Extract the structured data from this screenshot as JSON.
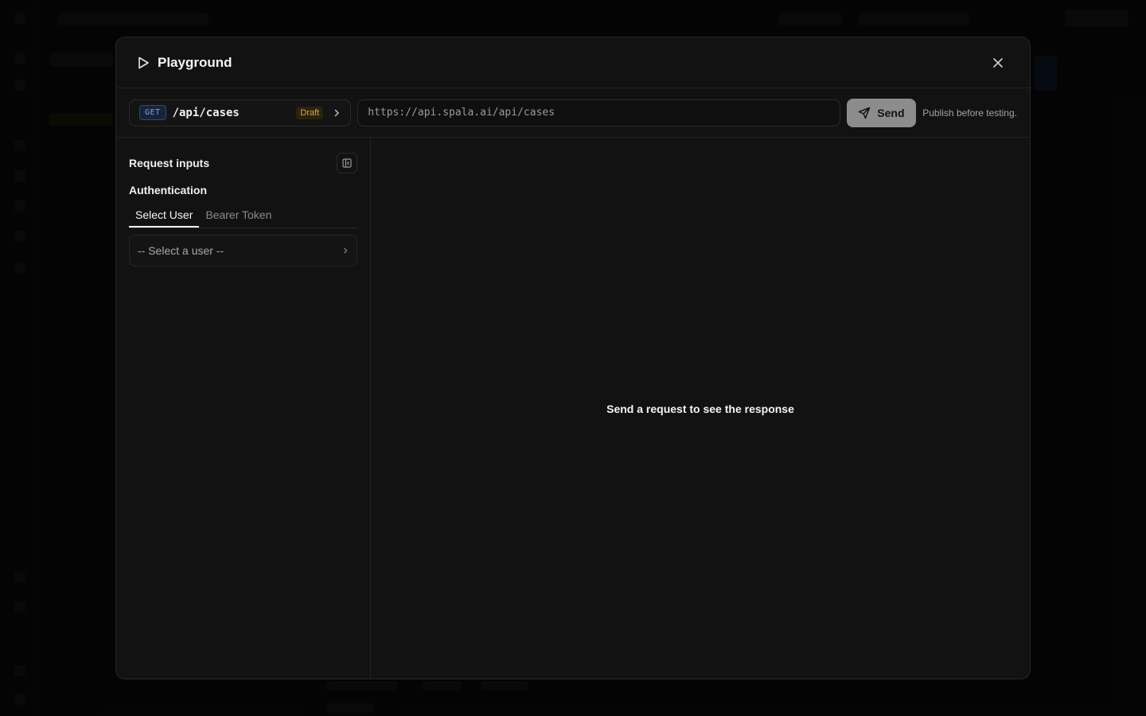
{
  "modal": {
    "title": "Playground",
    "close_icon": "close-icon",
    "title_icon": "play-icon"
  },
  "toolbar": {
    "method": "GET",
    "path": "/api/cases",
    "status": "Draft",
    "url": "https://api.spala.ai/api/cases",
    "send_label": "Send",
    "send_icon": "send-icon",
    "note": "Publish before testing."
  },
  "request_inputs": {
    "title": "Request inputs",
    "auth": {
      "title": "Authentication",
      "tabs": [
        {
          "label": "Select User",
          "active": true
        },
        {
          "label": "Bearer Token",
          "active": false
        }
      ],
      "user_select": {
        "placeholder": "-- Select a user --"
      }
    }
  },
  "response": {
    "empty_message": "Send a request to see the response"
  },
  "colors": {
    "method_badge": "#7aa2e8",
    "draft_badge": "#e0a82e",
    "send_button": "#8c8c8c"
  }
}
